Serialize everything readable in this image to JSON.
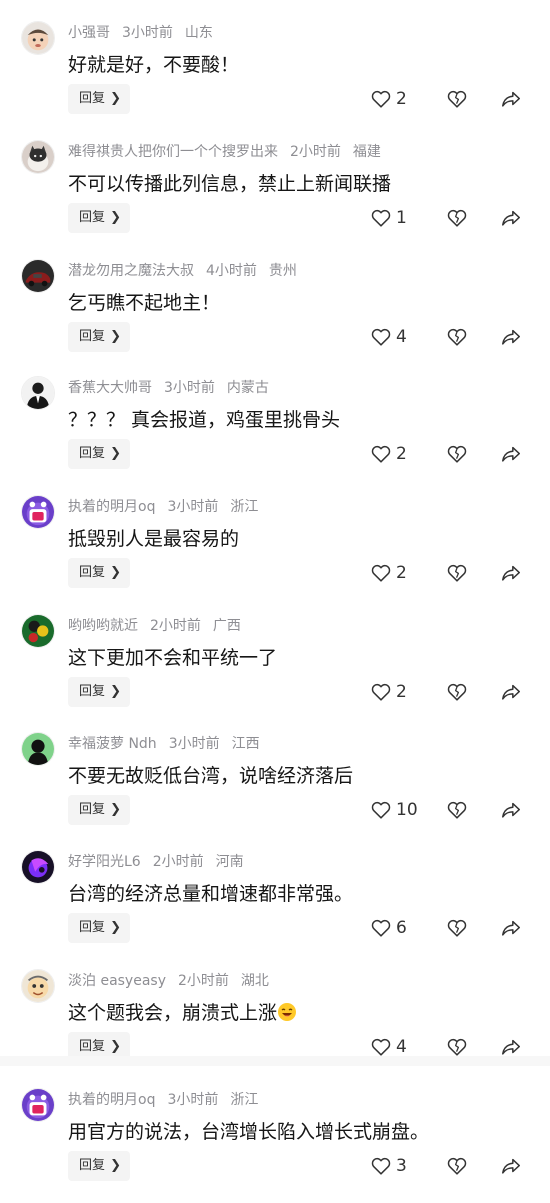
{
  "reply_label": "回复",
  "comments": [
    {
      "user": "小强哥",
      "time": "3小时前",
      "location": "山东",
      "text": "好就是好，不要酸！",
      "likes": "2",
      "avatar": "baby-avatar-icon"
    },
    {
      "user": "难得祺贵人把你们一个个搜罗出来",
      "time": "2小时前",
      "location": "福建",
      "text": "不可以传播此列信息，禁止上新闻联播",
      "likes": "1",
      "avatar": "cat-avatar-icon"
    },
    {
      "user": "潜龙勿用之魔法大叔",
      "time": "4小时前",
      "location": "贵州",
      "text": "乞丐瞧不起地主！",
      "likes": "4",
      "avatar": "car-avatar-icon"
    },
    {
      "user": "香蕉大大帅哥",
      "time": "3小时前",
      "location": "内蒙古",
      "text": "？？？ 真会报道，鸡蛋里挑骨头",
      "likes": "2",
      "avatar": "suit-avatar-icon"
    },
    {
      "user": "执着的明月oq",
      "time": "3小时前",
      "location": "浙江",
      "text": "抵毁别人是最容易的",
      "likes": "2",
      "avatar": "monster-avatar-icon"
    },
    {
      "user": "哟哟哟就近",
      "time": "2小时前",
      "location": "广西",
      "text": "这下更加不会和平统一了",
      "likes": "2",
      "avatar": "billiard-avatar-icon"
    },
    {
      "user": "幸福菠萝 Ndh",
      "time": "3小时前",
      "location": "江西",
      "text": "不要无故贬低台湾，说啥经济落后",
      "likes": "10",
      "avatar": "silhouette-avatar-icon"
    },
    {
      "user": "好学阳光L6",
      "time": "2小时前",
      "location": "河南",
      "text": "台湾的经济总量和增速都非常强。",
      "likes": "6",
      "avatar": "purple-abstract-avatar-icon"
    },
    {
      "user": "淡泊 easyeasy",
      "time": "2小时前",
      "location": "湖北",
      "text": "这个题我会，崩溃式上涨",
      "likes": "4",
      "avatar": "cartoon-face-avatar-icon",
      "emoji": "laughing-emoji-icon"
    },
    {
      "user": "执着的明月oq",
      "time": "3小时前",
      "location": "浙江",
      "text": "用官方的说法，台湾增长陷入增长式崩盘。",
      "likes": "3",
      "avatar": "monster-avatar-icon"
    }
  ],
  "colors": {
    "meta": "#8e8e93",
    "text": "#161616",
    "reply_bg": "#f4f4f4",
    "icon": "#333333"
  }
}
